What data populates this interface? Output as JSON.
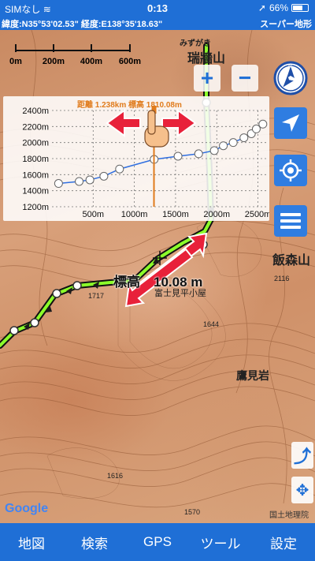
{
  "status": {
    "carrier": "SIMなし",
    "time": "0:13",
    "battery": "66%",
    "battery_level": 0.66
  },
  "coord_bar": {
    "coords": "緯度:N35°53'02.53\" 経度:E138°35'18.63\"",
    "map_type": "スーパー地形"
  },
  "scale": {
    "labels": [
      "0m",
      "200m",
      "400m",
      "600m"
    ]
  },
  "places": {
    "mizugaki": "みずがき",
    "mizugakiyama": "瑞牆山",
    "iimoriyama": "飯森山",
    "takamiiwa": "鷹見岩",
    "hut": "富士見平小屋",
    "spot_2116": "2116",
    "spot_1644": "1644",
    "spot_1616": "1616",
    "spot_1570": "1570",
    "spot_1717": "1717"
  },
  "cursor_elevation": {
    "prefix": "標高",
    "value": "10.08 m"
  },
  "profile": {
    "info": "距離 1.238km 標高 1810.08m",
    "cursor_distance_m": 1238
  },
  "chart_data": {
    "type": "line",
    "xlabel": "",
    "ylabel": "",
    "x_ticks": [
      "500m",
      "1000m",
      "1500m",
      "2000m",
      "2500m"
    ],
    "y_ticks": [
      "1200m",
      "1400m",
      "1600m",
      "1800m",
      "2000m",
      "2200m",
      "2400m"
    ],
    "xlim": [
      0,
      2600
    ],
    "ylim": [
      1200,
      2400
    ],
    "series": [
      {
        "x": [
          80,
          330,
          460,
          630,
          820,
          1240,
          1530,
          1780,
          1970,
          2080,
          2200,
          2330,
          2420,
          2480,
          2560
        ],
        "y": [
          1490,
          1515,
          1535,
          1580,
          1670,
          1790,
          1830,
          1860,
          1900,
          1960,
          2000,
          2060,
          2110,
          2170,
          2230
        ]
      }
    ]
  },
  "bottom_nav": [
    "地図",
    "検索",
    "GPS",
    "ツール",
    "設定"
  ],
  "attribution": {
    "google": "Google",
    "gsi": "国土地理院"
  }
}
